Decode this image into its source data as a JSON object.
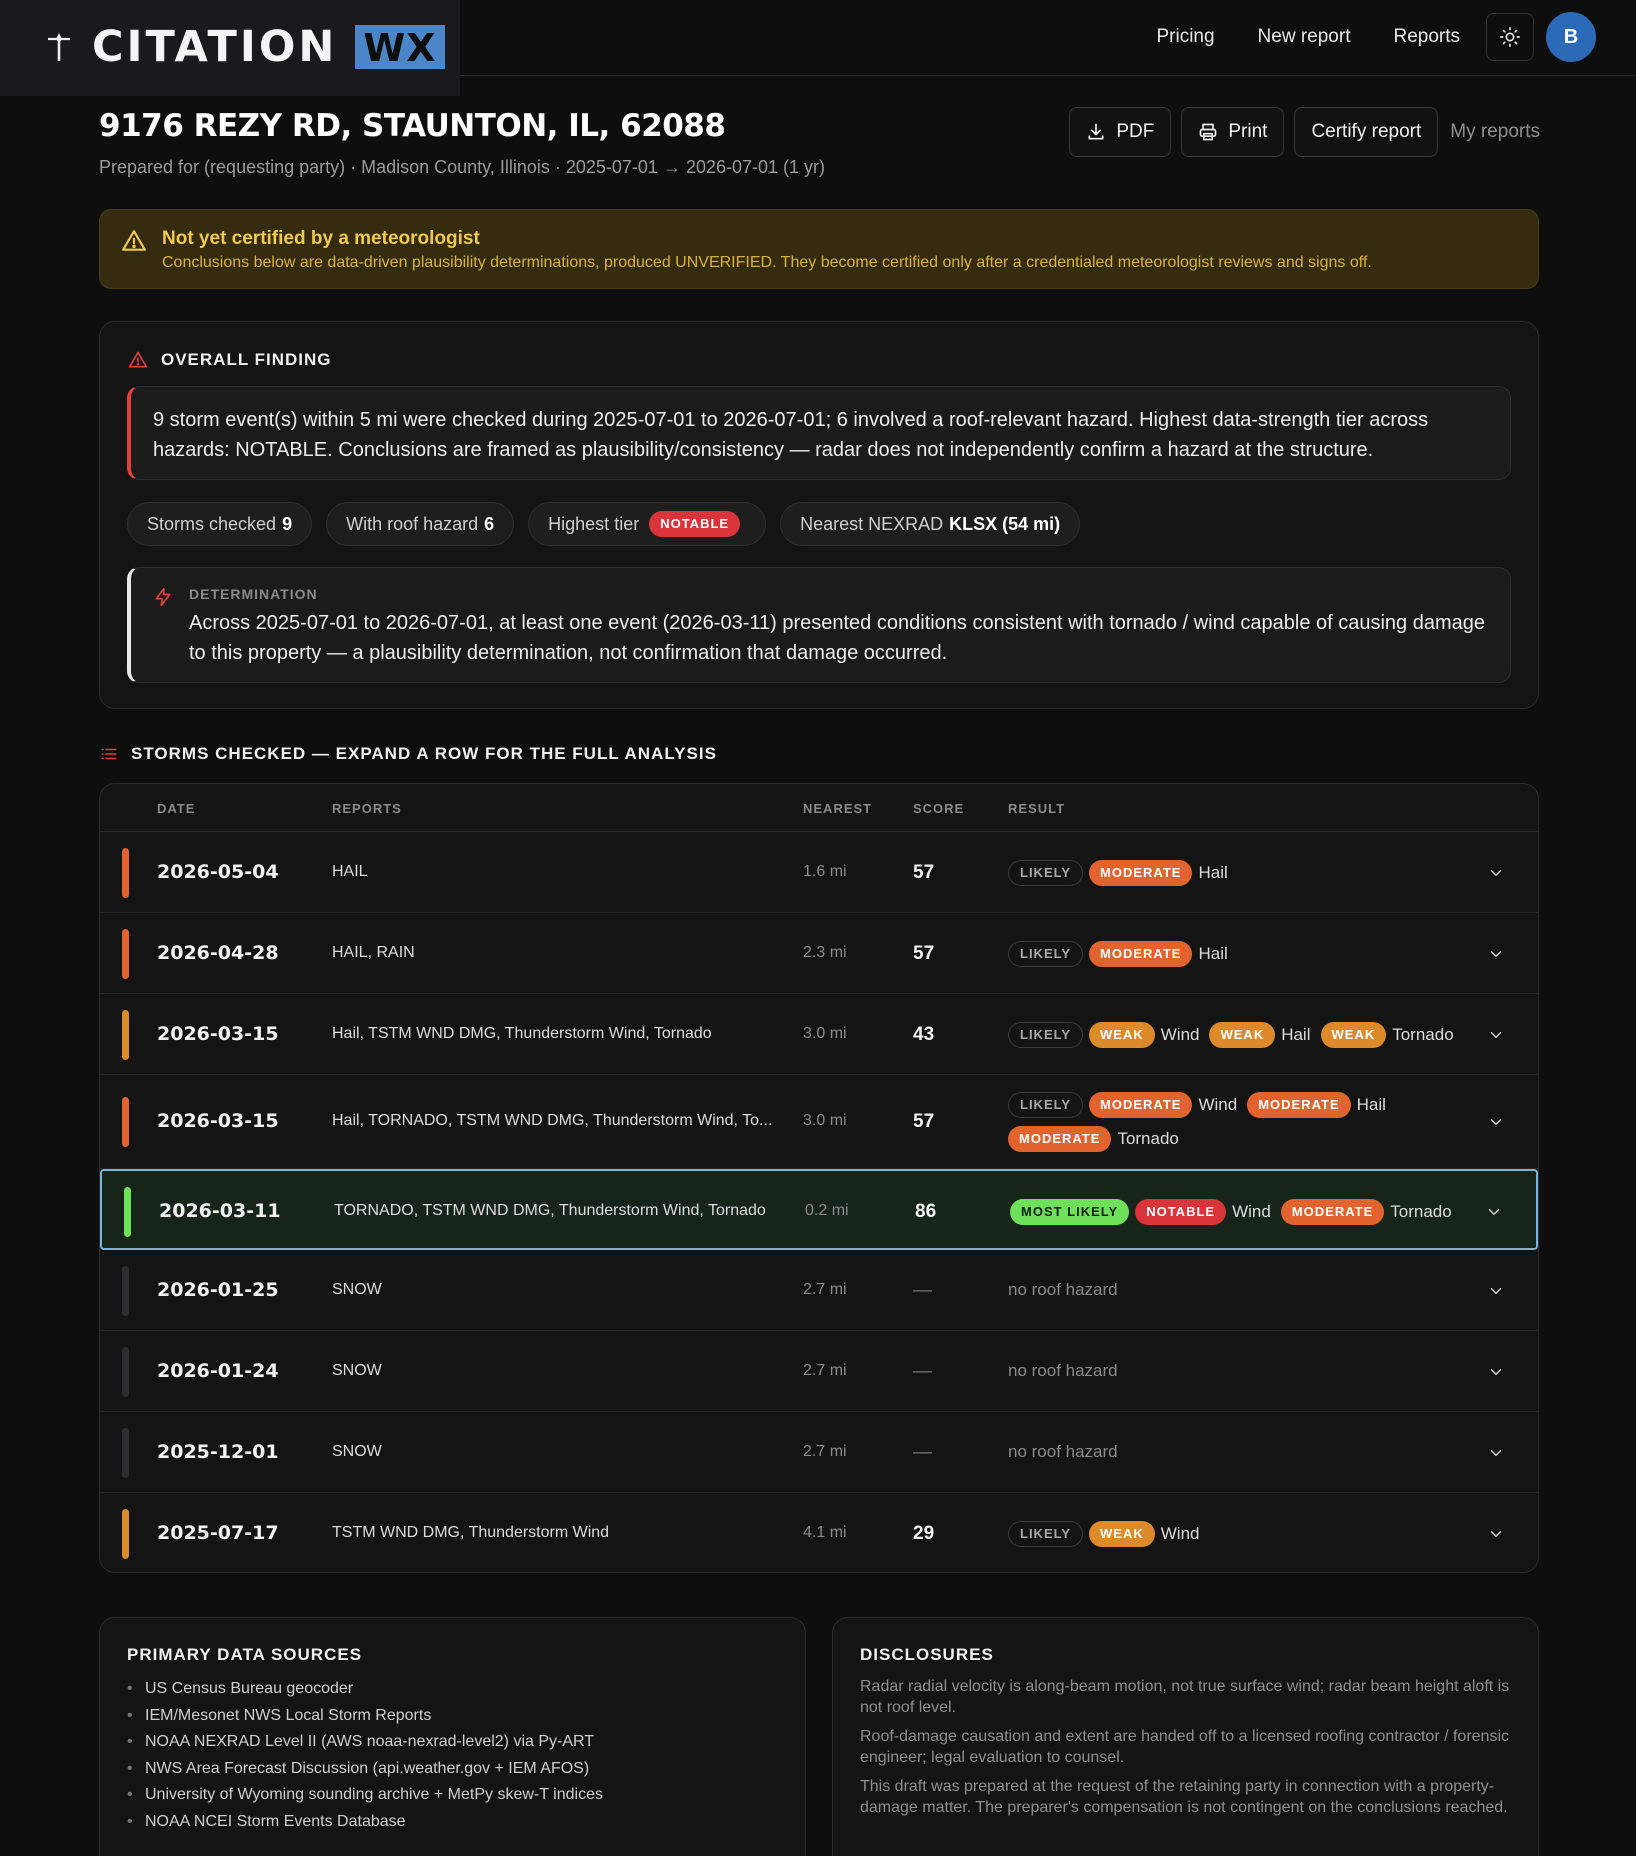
{
  "brand": {
    "name": "CITATION",
    "suffix": "WX"
  },
  "nav": {
    "pricing": "Pricing",
    "new_report": "New report",
    "reports": "Reports",
    "avatar": "B"
  },
  "header": {
    "title": "9176 REZY RD, STAUNTON, IL, 62088",
    "subtitle": "Prepared for (requesting party) · Madison County, Illinois · 2025-07-01 → 2026-07-01 (1 yr)",
    "pdf": "PDF",
    "print": "Print",
    "certify": "Certify report",
    "my_reports": "My reports"
  },
  "warning": {
    "title": "Not yet certified by a meteorologist",
    "text": "Conclusions below are data-driven plausibility determinations, produced UNVERIFIED. They become certified only after a credentialed meteorologist reviews and signs off."
  },
  "finding": {
    "heading": "OVERALL FINDING",
    "body": "9 storm event(s) within 5 mi were checked during 2025-07-01 to 2026-07-01; 6 involved a roof-relevant hazard. Highest data-strength tier across hazards: NOTABLE. Conclusions are framed as plausibility/consistency — radar does not independently confirm a hazard at the structure.",
    "chips": {
      "storms_label": "Storms checked",
      "storms_value": "9",
      "roof_label": "With roof hazard",
      "roof_value": "6",
      "tier_label": "Highest tier",
      "tier_value": "NOTABLE",
      "nexrad_label": "Nearest NEXRAD",
      "nexrad_value": "KLSX (54 mi)"
    },
    "determination_label": "DETERMINATION",
    "determination_text": "Across 2025-07-01 to 2026-07-01, at least one event (2026-03-11) presented conditions consistent with tornado / wind capable of causing damage to this property — a plausibility determination, not confirmation that damage occurred."
  },
  "storms": {
    "heading": "STORMS CHECKED — EXPAND A ROW FOR THE FULL ANALYSIS",
    "columns": {
      "date": "DATE",
      "reports": "REPORTS",
      "nearest": "NEAREST",
      "score": "SCORE",
      "result": "RESULT"
    },
    "rows": [
      {
        "date": "2026-05-04",
        "reports": "HAIL",
        "nearest": "1.6 mi",
        "score": "57",
        "bar_color": "#e2632e",
        "result": [
          [
            {
              "tag": "LIKELY",
              "kind": "likely"
            },
            {
              "tag": "MODERATE",
              "kind": "moderate",
              "hazard": "Hail"
            }
          ]
        ]
      },
      {
        "date": "2026-04-28",
        "reports": "HAIL, RAIN",
        "nearest": "2.3 mi",
        "score": "57",
        "bar_color": "#e2632e",
        "result": [
          [
            {
              "tag": "LIKELY",
              "kind": "likely"
            },
            {
              "tag": "MODERATE",
              "kind": "moderate",
              "hazard": "Hail"
            }
          ]
        ]
      },
      {
        "date": "2026-03-15",
        "reports": "Hail, TSTM WND DMG, Thunderstorm Wind, Tornado",
        "nearest": "3.0 mi",
        "score": "43",
        "bar_color": "#dc8a2a",
        "result": [
          [
            {
              "tag": "LIKELY",
              "kind": "likely"
            },
            {
              "tag": "WEAK",
              "kind": "weak",
              "hazard": "Wind"
            },
            {
              "tag": "WEAK",
              "kind": "weak",
              "hazard": "Hail"
            },
            {
              "tag": "WEAK",
              "kind": "weak",
              "hazard": "Tornado"
            }
          ]
        ]
      },
      {
        "date": "2026-03-15",
        "reports": "Hail, TORNADO, TSTM WND DMG, Thunderstorm Wind, To...",
        "nearest": "3.0 mi",
        "score": "57",
        "bar_color": "#e2632e",
        "result": [
          [
            {
              "tag": "LIKELY",
              "kind": "likely"
            },
            {
              "tag": "MODERATE",
              "kind": "moderate",
              "hazard": "Wind"
            },
            {
              "tag": "MODERATE",
              "kind": "moderate",
              "hazard": "Hail"
            }
          ],
          [
            {
              "tag": "MODERATE",
              "kind": "moderate",
              "hazard": "Tornado"
            }
          ]
        ]
      },
      {
        "date": "2026-03-11",
        "reports": "TORNADO, TSTM WND DMG, Thunderstorm Wind, Tornado",
        "nearest": "0.2 mi",
        "score": "86",
        "bar_color": "#6ee05a",
        "selected": true,
        "result": [
          [
            {
              "tag": "MOST LIKELY",
              "kind": "most"
            },
            {
              "tag": "NOTABLE",
              "kind": "notable",
              "hazard": "Wind"
            },
            {
              "tag": "MODERATE",
              "kind": "moderate",
              "hazard": "Tornado"
            }
          ]
        ]
      },
      {
        "date": "2026-01-25",
        "reports": "SNOW",
        "nearest": "2.7 mi",
        "score": "—",
        "bar_color": "#2e2e30",
        "none": "no roof hazard"
      },
      {
        "date": "2026-01-24",
        "reports": "SNOW",
        "nearest": "2.7 mi",
        "score": "—",
        "bar_color": "#2e2e30",
        "none": "no roof hazard"
      },
      {
        "date": "2025-12-01",
        "reports": "SNOW",
        "nearest": "2.7 mi",
        "score": "—",
        "bar_color": "#2e2e30",
        "none": "no roof hazard"
      },
      {
        "date": "2025-07-17",
        "reports": "TSTM WND DMG, Thunderstorm Wind",
        "nearest": "4.1 mi",
        "score": "29",
        "bar_color": "#dc8a2a",
        "result": [
          [
            {
              "tag": "LIKELY",
              "kind": "likely"
            },
            {
              "tag": "WEAK",
              "kind": "weak",
              "hazard": "Wind"
            }
          ]
        ]
      }
    ]
  },
  "sources": {
    "heading": "PRIMARY DATA SOURCES",
    "items": [
      "US Census Bureau geocoder",
      "IEM/Mesonet NWS Local Storm Reports",
      "NOAA NEXRAD Level II (AWS noaa-nexrad-level2) via Py-ART",
      "NWS Area Forecast Discussion (api.weather.gov + IEM AFOS)",
      "University of Wyoming sounding archive + MetPy skew-T indices",
      "NOAA NCEI Storm Events Database"
    ]
  },
  "disclosures": {
    "heading": "DISCLOSURES",
    "items": [
      "Radar radial velocity is along-beam motion, not true surface wind; radar beam height aloft is not roof level.",
      "Roof-damage causation and extent are handed off to a licensed roofing contractor / forensic engineer; legal evaluation to counsel.",
      "This draft was prepared at the request of the retaining party in connection with a property-damage matter. The preparer's compensation is not contingent on the conclusions reached."
    ]
  },
  "colors": {
    "accent": "#4a86c8",
    "danger": "#d9343a",
    "warning": "#f2c94c",
    "success": "#6ee05a"
  }
}
